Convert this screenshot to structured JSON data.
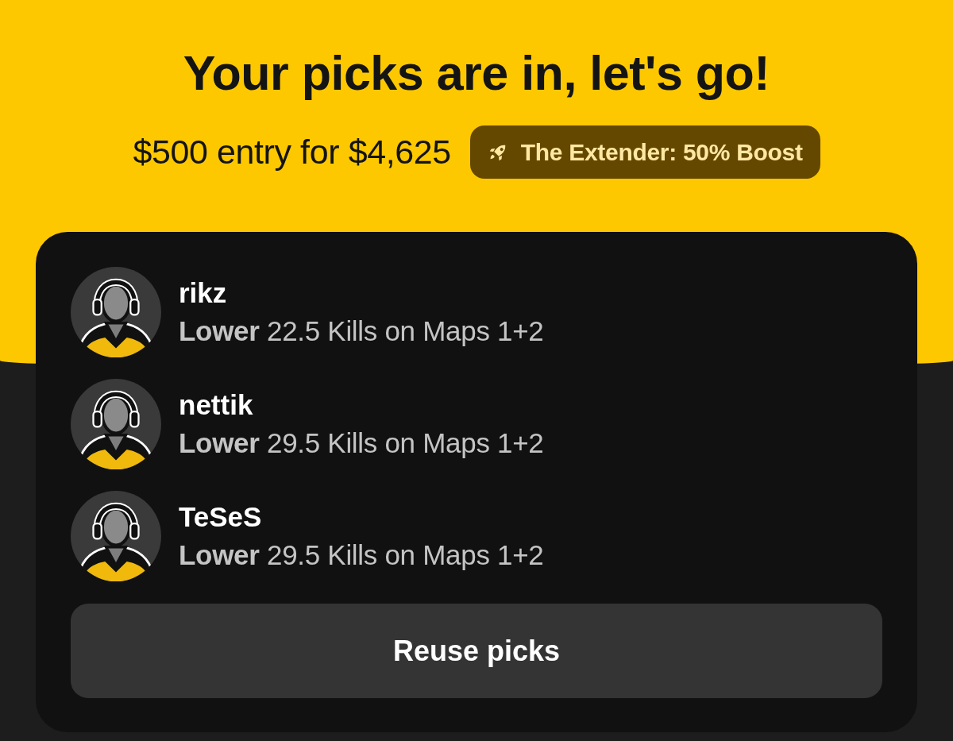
{
  "header": {
    "title": "Your picks are in, let's go!",
    "entry": "$500 entry for $4,625",
    "boost": {
      "label": "The Extender: 50% Boost"
    }
  },
  "picks": [
    {
      "player": "rikz",
      "pick": "**Lower** 22.5 Kills on Maps 1+2"
    },
    {
      "player": "nettik",
      "pick": "**Lower** 29.5 Kills on Maps 1+2"
    },
    {
      "player": "TeSeS",
      "pick": "**Lower** 29.5 Kills on Maps 1+2"
    }
  ],
  "reuse_button": {
    "label": "Reuse picks"
  }
}
